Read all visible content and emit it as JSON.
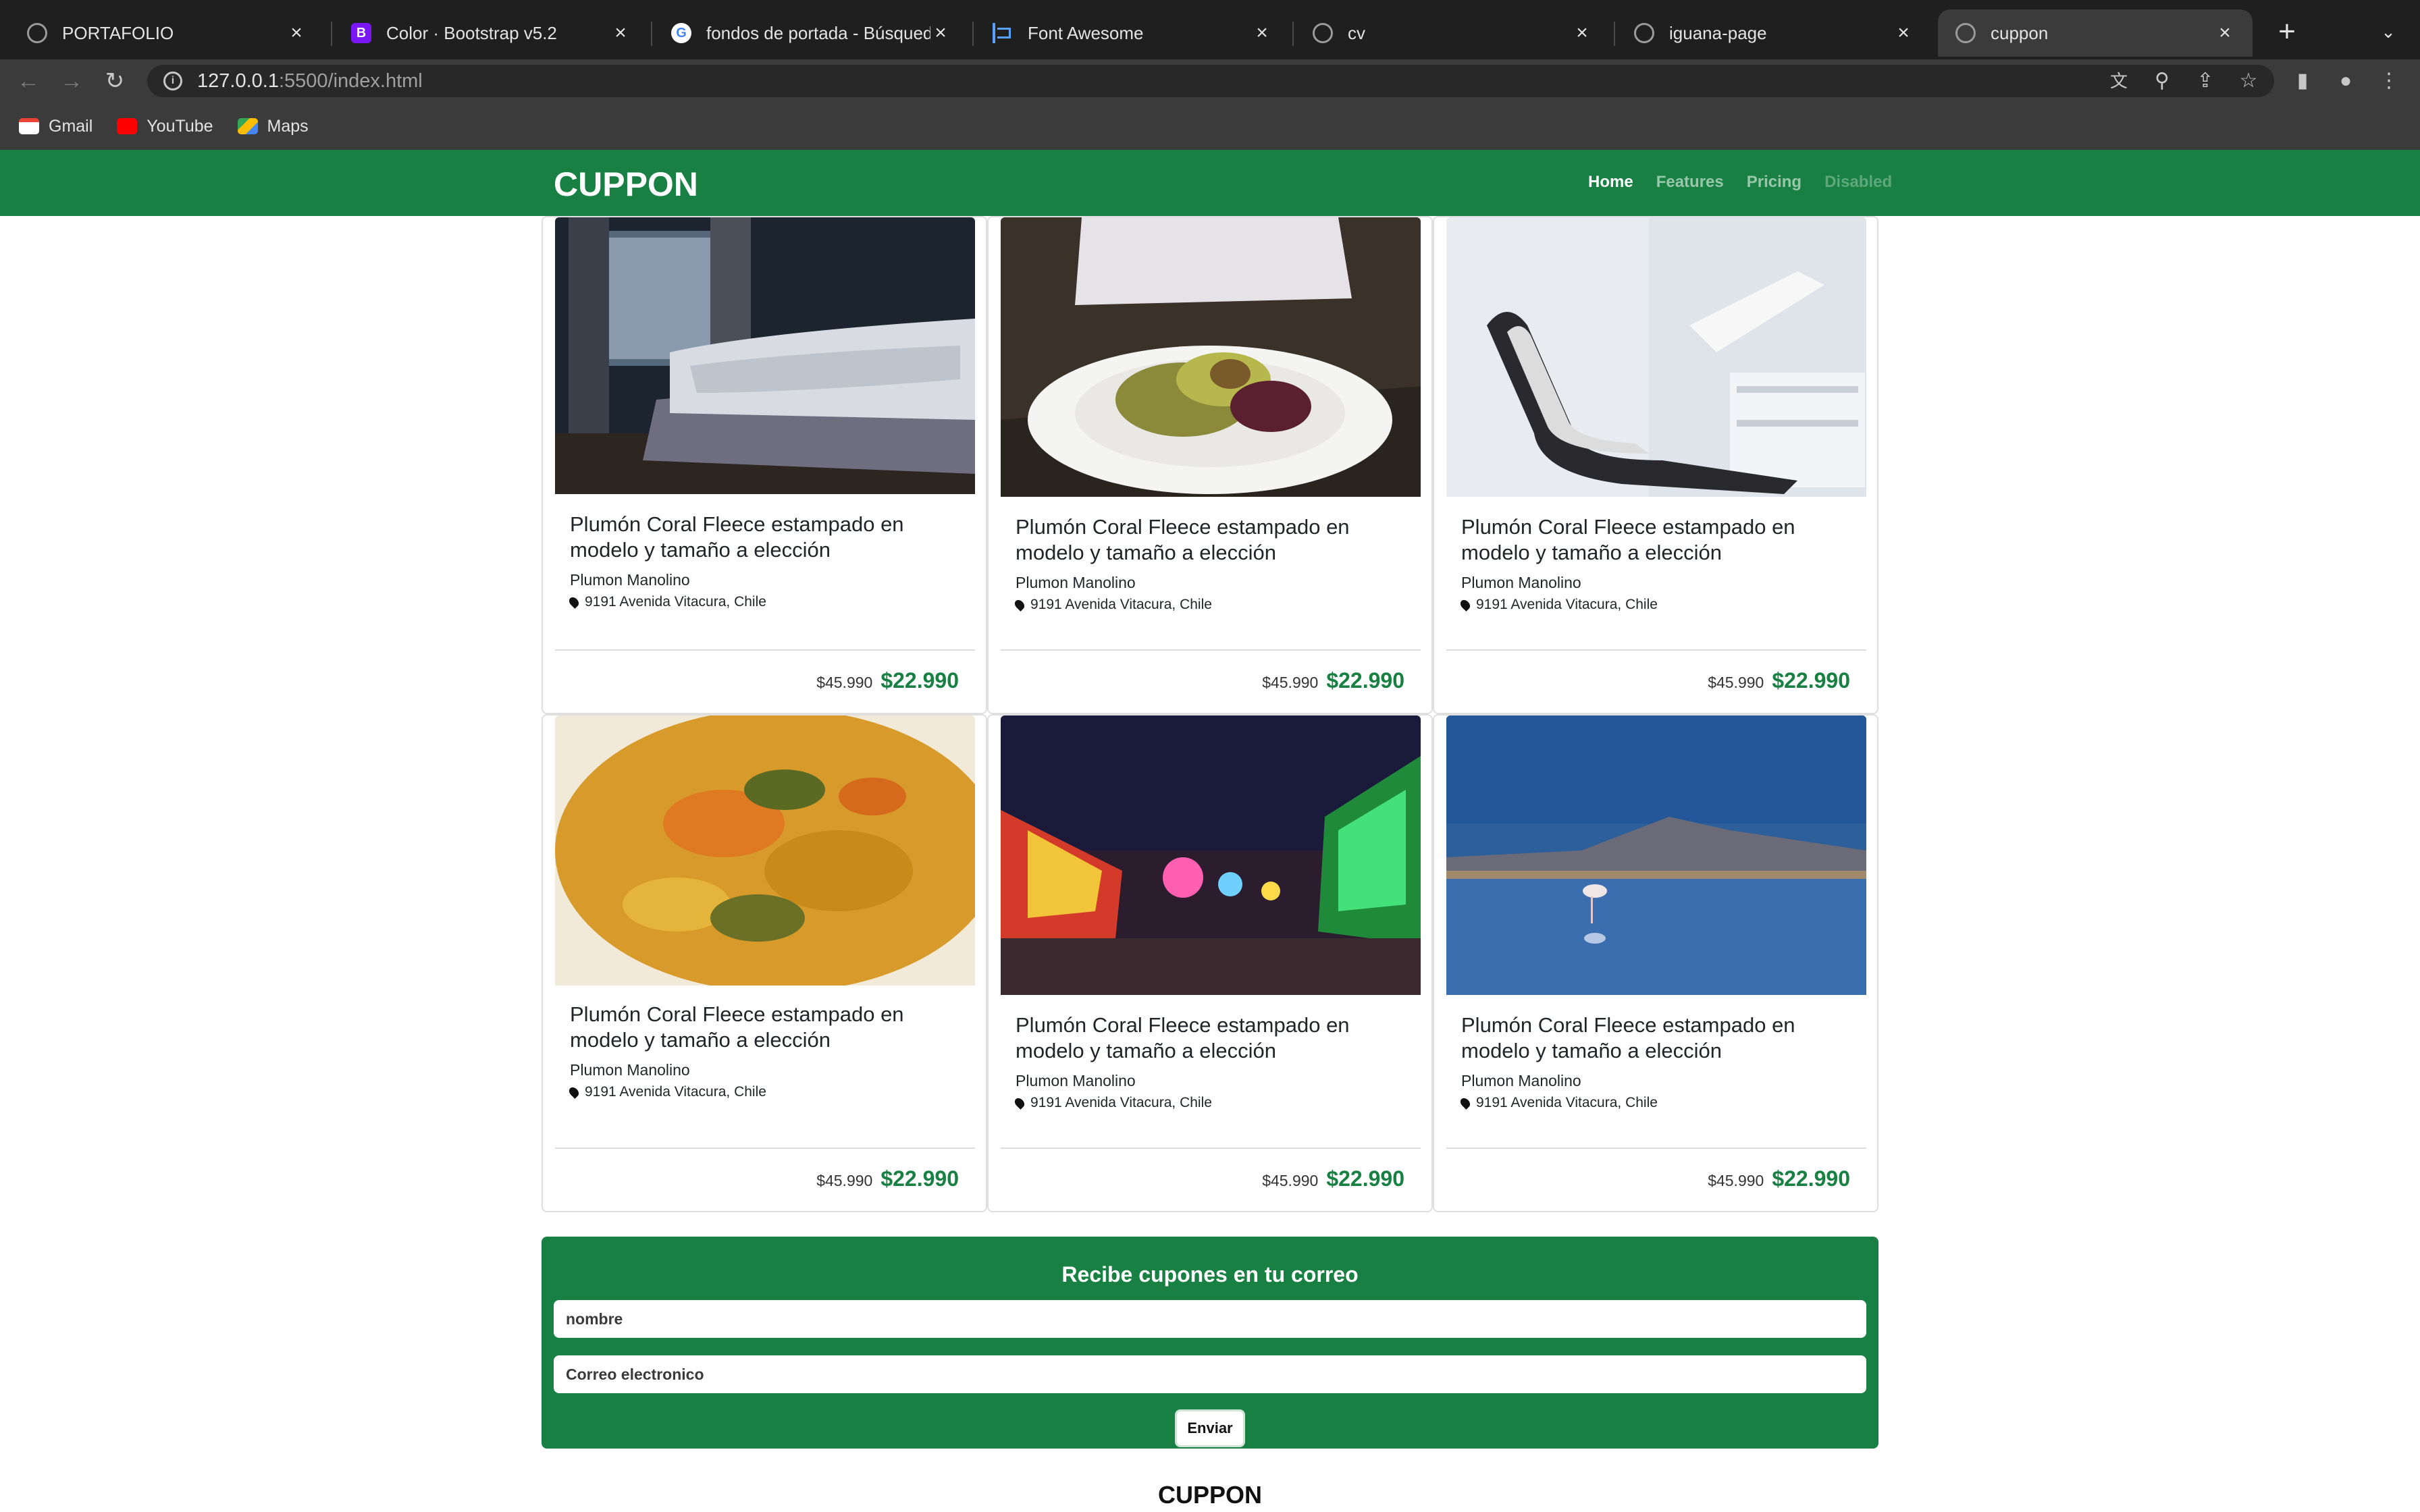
{
  "browser": {
    "tabs": [
      {
        "title": "PORTAFOLIO",
        "icon": "globe-icon"
      },
      {
        "title": "Color · Bootstrap v5.2",
        "icon": "bootstrap-icon"
      },
      {
        "title": "fondos de portada - Búsqueda",
        "icon": "google-icon"
      },
      {
        "title": "Font Awesome",
        "icon": "flag-icon"
      },
      {
        "title": "cv",
        "icon": "globe-icon"
      },
      {
        "title": "iguana-page",
        "icon": "globe-icon"
      },
      {
        "title": "cuppon",
        "icon": "globe-icon",
        "active": true
      }
    ],
    "url_host": "127.0.0.1",
    "url_path": ":5500/index.html",
    "bookmarks": [
      {
        "label": "Gmail",
        "icon": "gmail-icon"
      },
      {
        "label": "YouTube",
        "icon": "youtube-icon"
      },
      {
        "label": "Maps",
        "icon": "maps-icon"
      }
    ]
  },
  "navbar": {
    "brand": "CUPPON",
    "links": [
      {
        "label": "Home",
        "state": "active"
      },
      {
        "label": "Features",
        "state": "normal"
      },
      {
        "label": "Pricing",
        "state": "normal"
      },
      {
        "label": "Disabled",
        "state": "disabled"
      }
    ]
  },
  "cards": [
    {
      "image": "bedroom-photo",
      "title": "Plumón Coral Fleece estampado en modelo y tamaño a elección",
      "merchant": "Plumon Manolino",
      "address": "9191 Avenida Vitacura, Chile",
      "old_price": "$45.990",
      "new_price": "$22.990"
    },
    {
      "image": "salad-plate-photo",
      "title": "Plumón Coral Fleece estampado en modelo y tamaño a elección",
      "merchant": "Plumon Manolino",
      "address": "9191 Avenida Vitacura, Chile",
      "old_price": "$45.990",
      "new_price": "$22.990"
    },
    {
      "image": "dental-chair-photo",
      "title": "Plumón Coral Fleece estampado en modelo y tamaño a elección",
      "merchant": "Plumon Manolino",
      "address": "9191 Avenida Vitacura, Chile",
      "old_price": "$45.990",
      "new_price": "$22.990"
    },
    {
      "image": "vegetable-stew-photo",
      "title": "Plumón Coral Fleece estampado en modelo y tamaño a elección",
      "merchant": "Plumon Manolino",
      "address": "9191 Avenida Vitacura, Chile",
      "old_price": "$45.990",
      "new_price": "$22.990"
    },
    {
      "image": "night-fair-photo",
      "title": "Plumón Coral Fleece estampado en modelo y tamaño a elección",
      "merchant": "Plumon Manolino",
      "address": "9191 Avenida Vitacura, Chile",
      "old_price": "$45.990",
      "new_price": "$22.990"
    },
    {
      "image": "flamingo-lake-photo",
      "title": "Plumón Coral Fleece estampado en modelo y tamaño a elección",
      "merchant": "Plumon Manolino",
      "address": "9191 Avenida Vitacura, Chile",
      "old_price": "$45.990",
      "new_price": "$22.990"
    }
  ],
  "newsletter": {
    "title": "Recibe cupones en tu correo",
    "name_placeholder": "nombre",
    "email_placeholder": "Correo electronico",
    "submit_label": "Enviar"
  },
  "footer": {
    "brand": "CUPPON"
  },
  "colors": {
    "brand_green": "#198043",
    "chrome_dark": "#1f1f1f",
    "chrome_mid": "#3b3b3b"
  }
}
